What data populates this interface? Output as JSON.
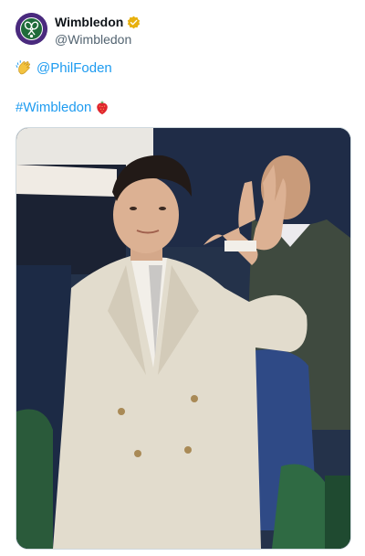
{
  "account": {
    "display_name": "Wimbledon",
    "handle": "@Wimbledon",
    "verified_color": "#e8b10f"
  },
  "tweet": {
    "mention": "@PhilFoden",
    "hashtag": "#Wimbledon",
    "emoji_1": "clapping-hands",
    "emoji_2": "strawberry"
  },
  "media": {
    "description_icon": "photo"
  },
  "colors": {
    "link": "#1d9bf0",
    "handle": "#536471",
    "brand_purple": "#4a2a7e",
    "brand_green": "#1f6b3a"
  }
}
